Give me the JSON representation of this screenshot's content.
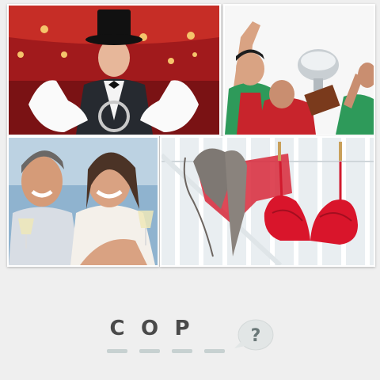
{
  "puzzle": {
    "letters": [
      "C",
      "O",
      "P",
      ""
    ],
    "slots": 4,
    "help_symbol": "?"
  },
  "images": [
    {
      "subject": "magician"
    },
    {
      "subject": "trophy"
    },
    {
      "subject": "couple-with-wine"
    },
    {
      "subject": "bras-on-clothesline"
    }
  ],
  "colors": {
    "background": "#efefef",
    "letter": "#4a4a4a",
    "slot_bar": "#c7d1d1",
    "help_bubble": "#e2e6e6",
    "help_mark": "#6a7878"
  }
}
